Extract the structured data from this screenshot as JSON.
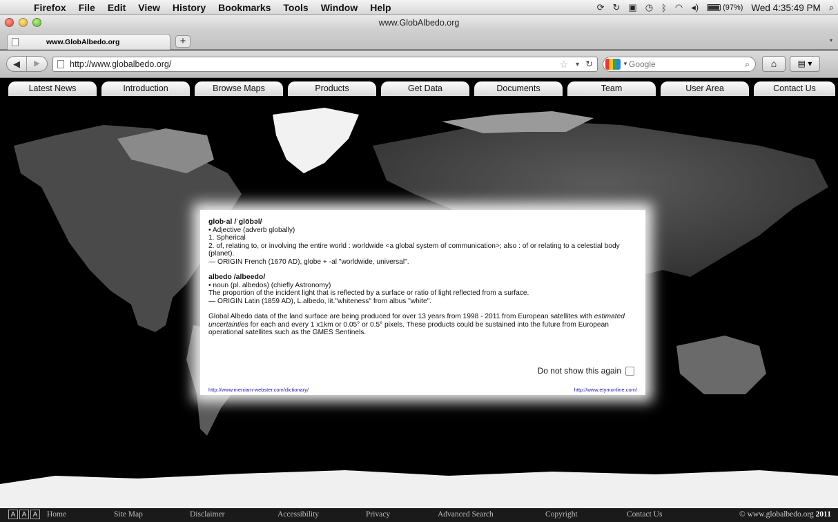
{
  "menubar": {
    "items": [
      "Firefox",
      "File",
      "Edit",
      "View",
      "History",
      "Bookmarks",
      "Tools",
      "Window",
      "Help"
    ],
    "battery": "(97%)",
    "clock": "Wed 4:35:49 PM",
    "battery_level": 0.97
  },
  "window": {
    "title": "www.GlobAlbedo.org"
  },
  "tab": {
    "title": "www.GlobAlbedo.org",
    "new_tab_label": "+"
  },
  "navbar": {
    "url": "http://www.globalbedo.org/",
    "search_engine": "Google"
  },
  "site_nav": {
    "items": [
      "Latest News",
      "Introduction",
      "Browse Maps",
      "Products",
      "Get Data",
      "Documents",
      "Team",
      "User Area",
      "Contact Us"
    ]
  },
  "dialog": {
    "global_term": "glob·al /ˈglōbəl/",
    "global_pos": "• Adjective (adverb globally)",
    "global_def1": "1. Spherical",
    "global_def2": "2. of, relating to, or involving the entire world : worldwide <a global system of communication>; also : of or relating to a celestial body (planet).",
    "global_origin": "— ORIGIN French (1670 AD), globe + -al \"worldwide, universal\".",
    "albedo_term": "albedo /albeedo/",
    "albedo_pos": "• noun (pl. albedos) (chiefly Astronomy)",
    "albedo_def": "The proportion of the incident light that is reflected by a surface or ratio of light reflected from a surface.",
    "albedo_origin": "— ORIGIN Latin (1859 AD), L.albedo, lit.\"whiteness\" from albus \"white\".",
    "paragraph_start": "Global Albedo data of the land surface are being produced for over 13 years from 1998 - 2011 from European satellites with ",
    "paragraph_italic": "estimated uncertainties",
    "paragraph_end": " for each and every 1 x1km or 0.05° or 0.5° pixels. These products could be sustained into the future from European operational satellites such as the GMES Sentinels.",
    "dont_show": "Do not show this again",
    "link_left": "http://www.merriam-webster.com/dictionary/",
    "link_right": "http://www.etymonline.com/"
  },
  "footer": {
    "access_icons": [
      "A",
      "A",
      "A"
    ],
    "links": [
      "Home",
      "Site Map",
      "Disclaimer",
      "Accessibility",
      "Privacy",
      "Advanced Search",
      "Copyright",
      "Contact Us"
    ],
    "copyright_prefix": "© www.globalbedo.org ",
    "copyright_year": "2011"
  }
}
